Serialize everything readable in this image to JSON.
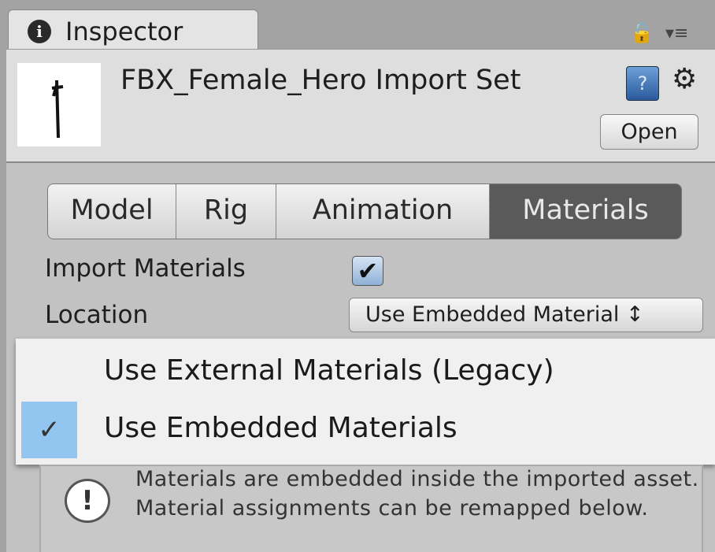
{
  "window": {
    "tab_label": "Inspector",
    "tab_icon": "info-icon"
  },
  "header": {
    "title": "FBX_Female_Hero Import Set",
    "open_label": "Open",
    "help_icon": "help-book-icon",
    "settings_icon": "gear-icon"
  },
  "tabs": [
    {
      "label": "Model"
    },
    {
      "label": "Rig"
    },
    {
      "label": "Animation"
    },
    {
      "label": "Materials",
      "selected": true
    }
  ],
  "fields": {
    "import_materials_label": "Import Materials",
    "import_materials_checked": true,
    "location_label": "Location",
    "location_value": "Use Embedded Material ↕"
  },
  "popup": {
    "options": [
      {
        "label": "Use External Materials (Legacy)",
        "checked": false
      },
      {
        "label": "Use Embedded Materials",
        "checked": true
      }
    ],
    "highlight_color": "#92c6f0"
  },
  "helpbox": {
    "icon": "warning-icon",
    "text": "Materials are embedded inside the imported asset. Material assignments can be remapped below."
  }
}
